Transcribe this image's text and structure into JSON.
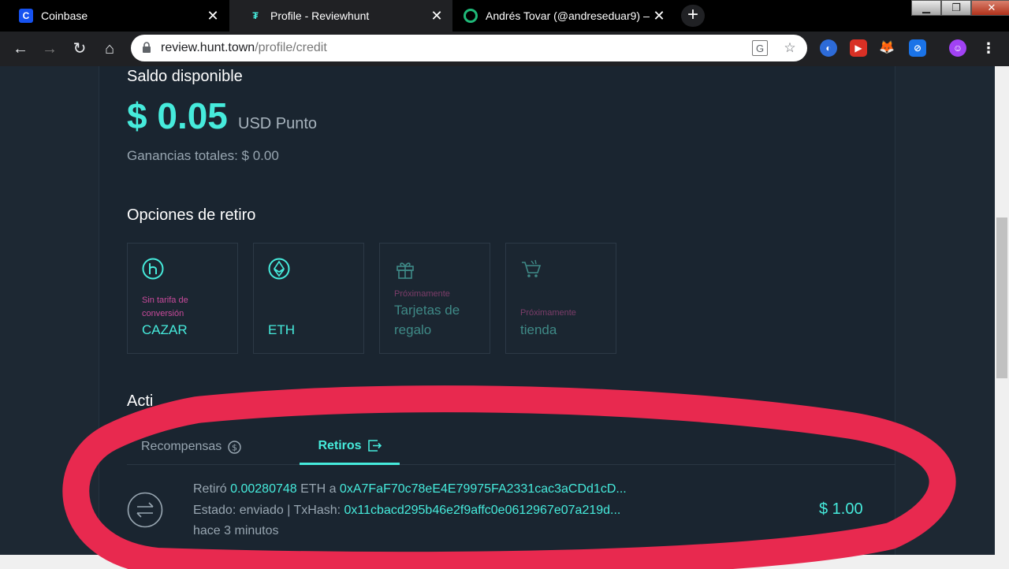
{
  "browser": {
    "tabs": [
      {
        "title": "Coinbase",
        "favicon_letter": "C",
        "favicon_color": "#1652f0"
      },
      {
        "title": "Profile - Reviewhunt",
        "favicon_letter": "₮",
        "favicon_color": "#2b3b47"
      },
      {
        "title": "Andrés Tovar (@andreseduar9) —",
        "favicon_letter": "",
        "favicon_color": "#1fb979"
      }
    ],
    "url_host": "review.hunt.town",
    "url_path": "/profile/credit"
  },
  "balance": {
    "heading": "Saldo disponible",
    "amount": "$ 0.05",
    "unit": "USD Punto",
    "total_earnings": "Ganancias totales: $ 0.00"
  },
  "withdraw_options": {
    "heading": "Opciones de retiro",
    "items": [
      {
        "note": "Sin tarifa de conversión",
        "label": "CAZAR",
        "icon": "hunt-icon"
      },
      {
        "note": "",
        "label": "ETH",
        "icon": "ethereum-icon"
      },
      {
        "note": "Próximamente",
        "label": "Tarjetas de regalo",
        "icon": "gift-icon"
      },
      {
        "note": "Próximamente",
        "label": "tienda",
        "icon": "cart-icon"
      }
    ]
  },
  "activity": {
    "heading": "Acti",
    "tabs": [
      {
        "label": "Recompensas",
        "active": false
      },
      {
        "label": "Retiros",
        "active": true
      }
    ],
    "rows": [
      {
        "withdrew_prefix": "Retiró",
        "eth_amount": "0.00280748",
        "eth_unit": "ETH a",
        "address": "0xA7FaF70c78eE4E79975FA2331cac3aCDd1cD...",
        "status": "Estado: enviado | TxHash:",
        "txhash": "0x11cbacd295b46e2f9affc0e0612967e07a219d...",
        "time": "hace 3 minutos",
        "usd": "$ 1.00"
      }
    ]
  },
  "colors": {
    "accent": "#46ebdc",
    "pink": "#c84a9b",
    "highlight": "#e8294f"
  }
}
